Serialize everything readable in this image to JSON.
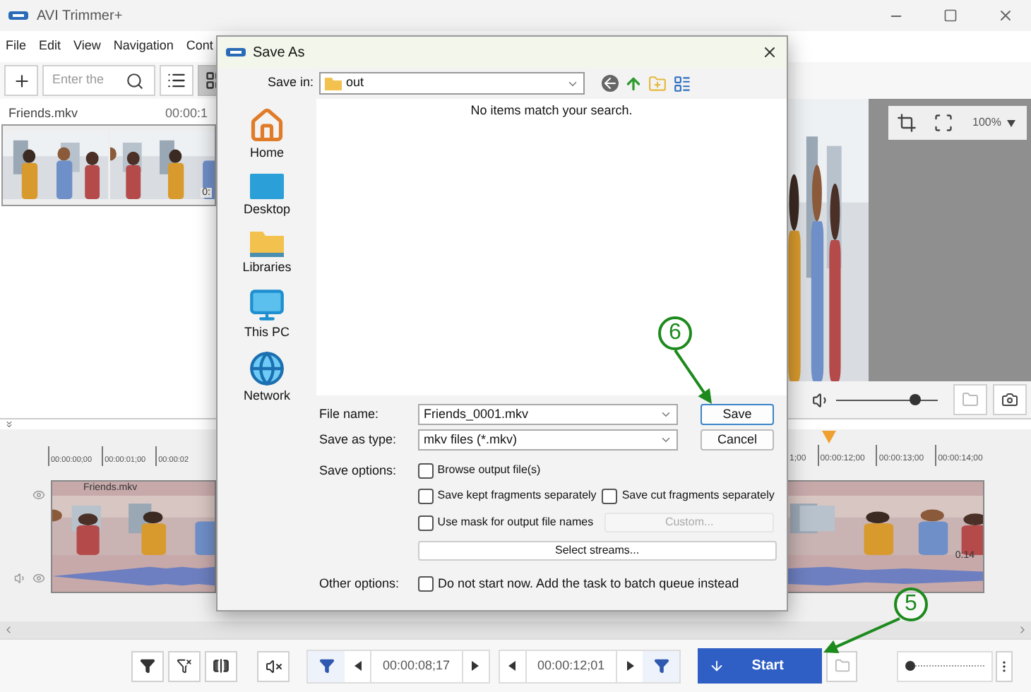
{
  "window": {
    "title": "AVI Trimmer+"
  },
  "menu": [
    "File",
    "Edit",
    "View",
    "Navigation",
    "Cont"
  ],
  "toolbar": {
    "search": {
      "placeholder": "Enter the"
    },
    "view_modes": [
      {
        "kind": "list",
        "selected": false
      },
      {
        "kind": "grid",
        "selected": true
      }
    ]
  },
  "file_list": [
    {
      "name": "Friends.mkv",
      "duration": "00:00:1",
      "thumb_time": "0:"
    }
  ],
  "preview": {
    "zoom": "100%",
    "volume": {
      "level": 0.78
    }
  },
  "timeline": {
    "ruler_left": [
      "00:00:00;00",
      "00:00:01;00",
      "00:00:02"
    ],
    "ruler_right": [
      "1;00",
      "00:00:12;00",
      "00:00:13;00",
      "00:00:14;00"
    ],
    "clips": [
      {
        "label": "Friends.mkv"
      },
      {
        "label": "0:14"
      }
    ]
  },
  "bottom": {
    "start_time": "00:00:08;17",
    "end_time": "00:00:12;01",
    "start_button": "Start",
    "scale": {
      "level": 0.05
    }
  },
  "dialog": {
    "title": "Save As",
    "save_in_label": "Save in:",
    "save_in": "out",
    "places": [
      {
        "kind": "home",
        "label": "Home"
      },
      {
        "kind": "desktop",
        "label": "Desktop"
      },
      {
        "kind": "libraries",
        "label": "Libraries"
      },
      {
        "kind": "pc",
        "label": "This PC"
      },
      {
        "kind": "network",
        "label": "Network"
      }
    ],
    "empty_message": "No items match your search.",
    "fields": [
      {
        "label": "File name:",
        "value": "Friends_0001.mkv"
      },
      {
        "label": "Save as type:",
        "value": "mkv files (*.mkv)"
      }
    ],
    "buttons": [
      "Save",
      "Cancel"
    ],
    "save_options_label": "Save options:",
    "option_rows": [
      {
        "kind": "checks",
        "items": [
          {
            "label": "Browse output file(s)",
            "checked": false
          }
        ]
      },
      {
        "kind": "checks",
        "items": [
          {
            "label": "Save kept fragments separately",
            "checked": false
          },
          {
            "label": "Save cut fragments separately",
            "checked": false
          }
        ]
      },
      {
        "kind": "check_button",
        "items": [
          {
            "label": "Use mask for output file names",
            "checked": false
          }
        ],
        "button": {
          "label": "Custom...",
          "disabled": true
        }
      },
      {
        "kind": "button",
        "button": {
          "label": "Select streams...",
          "disabled": false
        }
      }
    ],
    "other_options_label": "Other options:",
    "other_option": {
      "label": "Do not start now. Add the task to batch queue instead",
      "checked": false
    }
  },
  "annotations": [
    {
      "number": "6"
    },
    {
      "number": "5"
    }
  ]
}
